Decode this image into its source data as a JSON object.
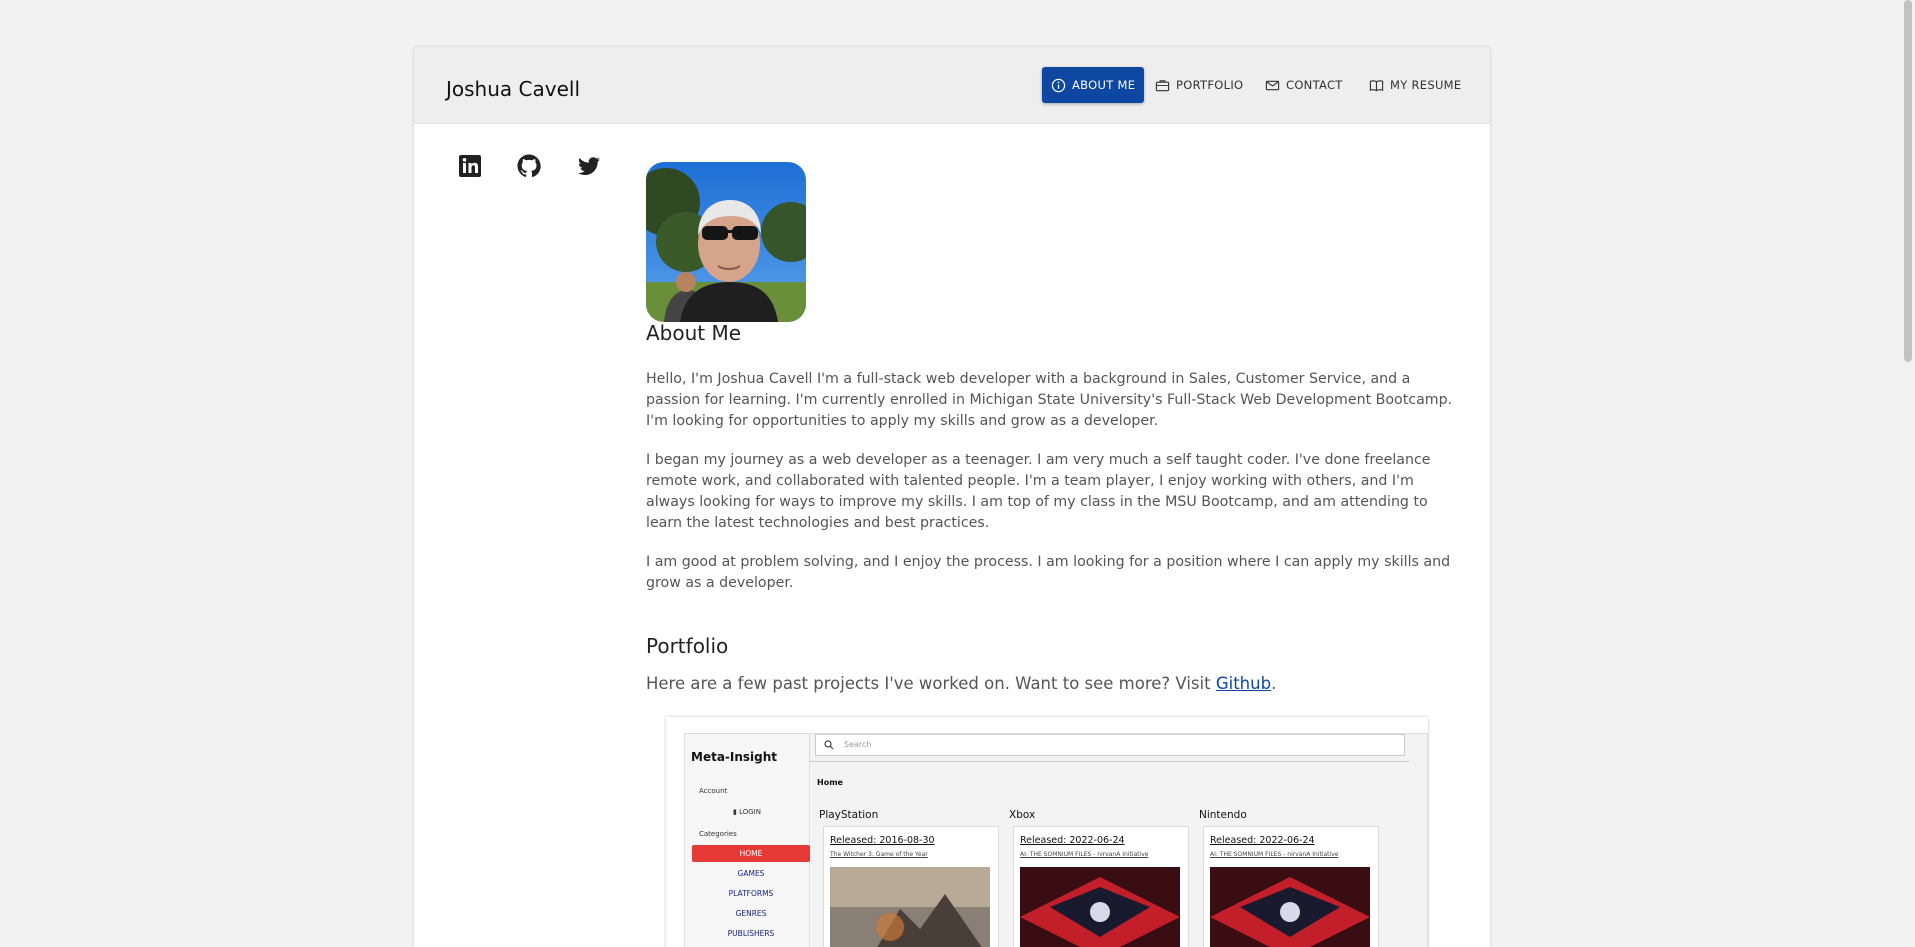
{
  "header": {
    "title": "Joshua Cavell",
    "nav": [
      {
        "label": "ABOUT ME",
        "icon": "info-icon",
        "active": true
      },
      {
        "label": "PORTFOLIO",
        "icon": "briefcase-icon"
      },
      {
        "label": "CONTACT",
        "icon": "envelope-icon"
      },
      {
        "label": "MY RESUME",
        "icon": "book-icon"
      }
    ]
  },
  "social": [
    {
      "icon": "linkedin-icon"
    },
    {
      "icon": "github-icon"
    },
    {
      "icon": "twitter-icon"
    }
  ],
  "about": {
    "heading": "About Me",
    "paragraphs": [
      "Hello, I'm Joshua Cavell I'm a full-stack web developer with a background in Sales, Customer Service, and a passion for learning. I'm currently enrolled in Michigan State University's Full-Stack Web Development Bootcamp. I'm looking for opportunities to apply my skills and grow as a developer.",
      "I began my journey as a web developer as a teenager. I am very much a self taught coder. I've done freelance remote work, and collaborated with talented people. I'm a team player, I enjoy working with others, and I'm always looking for ways to improve my skills. I am top of my class in the MSU Bootcamp, and am attending to learn the latest technologies and best practices.",
      "I am good at problem solving, and I enjoy the process. I am looking for a position where I can apply my skills and grow as a developer."
    ]
  },
  "portfolio": {
    "heading": "Portfolio",
    "intro_before": "Here are a few past projects I've worked on. Want to see more? Visit ",
    "intro_link": "Github",
    "intro_after": "."
  },
  "project_preview": {
    "brand": "Meta-Insight",
    "search_placeholder": "Search",
    "account_label": "Account",
    "login_label": "LOGIN",
    "categories_label": "Categories",
    "menu": [
      "HOME",
      "GAMES",
      "PLATFORMS",
      "GENRES",
      "PUBLISHERS"
    ],
    "breadcrumb": "Home",
    "columns": [
      {
        "title": "PlayStation",
        "released": "Released: 2016-08-30",
        "game": "The Witcher 3: Game of the Year"
      },
      {
        "title": "Xbox",
        "released": "Released: 2022-06-24",
        "game": "AI: THE SOMNIUM FILES - nirvanA Initiative"
      },
      {
        "title": "Nintendo",
        "released": "Released: 2022-06-24",
        "game": "AI: THE SOMNIUM FILES - nirvanA Initiative"
      }
    ]
  },
  "colors": {
    "accent": "#0d47a1",
    "home_button": "#e53935"
  }
}
